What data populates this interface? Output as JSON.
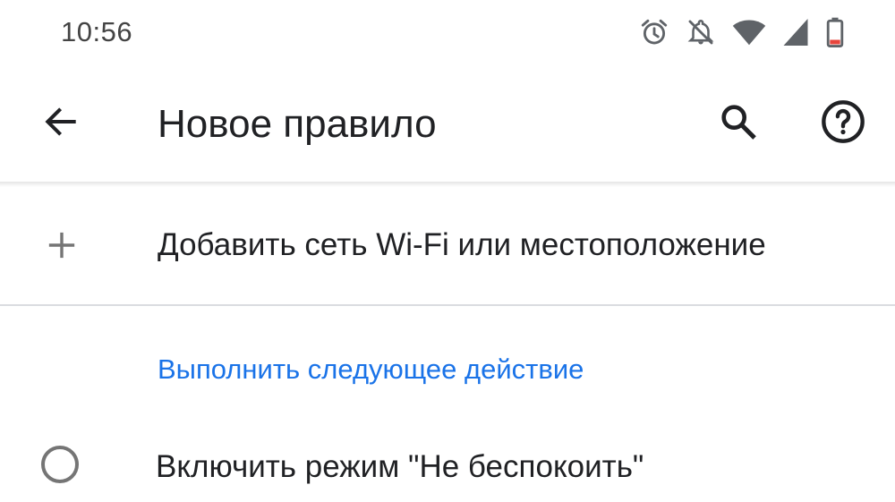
{
  "status_bar": {
    "time": "10:56",
    "icons": [
      "alarm-icon",
      "notifications-off-icon",
      "wifi-icon",
      "cell-signal-icon",
      "battery-low-icon"
    ],
    "battery_color": "#e8453c"
  },
  "app_bar": {
    "title": "Новое правило",
    "back_icon": "arrow-back-icon",
    "search_icon": "search-icon",
    "help_icon": "help-icon"
  },
  "add_row": {
    "icon": "plus-icon",
    "label": "Добавить сеть Wi-Fi или местоположение"
  },
  "action_section": {
    "header": "Выполнить следующее действие",
    "header_color": "#1a73e8",
    "options": [
      {
        "label": "Включить режим \"Не беспокоить\"",
        "selected": false
      }
    ]
  }
}
